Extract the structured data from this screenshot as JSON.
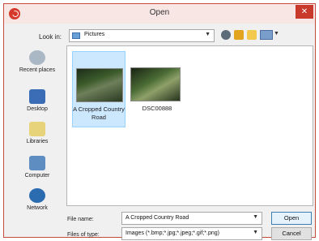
{
  "window": {
    "title": "Open"
  },
  "lookin": {
    "label": "Look in:",
    "value": "Pictures"
  },
  "places": [
    {
      "label": "Recent places"
    },
    {
      "label": "Desktop"
    },
    {
      "label": "Libraries"
    },
    {
      "label": "Computer"
    },
    {
      "label": "Network"
    }
  ],
  "files": [
    {
      "name": "A Cropped Country Road",
      "selected": true
    },
    {
      "name": "DSC00888",
      "selected": false
    }
  ],
  "filename": {
    "label": "File name:",
    "value": "A Cropped Country Road"
  },
  "filetype": {
    "label": "Files of type:",
    "value": "Images (*.bmp;*.jpg;*.jpeg;*.gif;*.png)"
  },
  "buttons": {
    "open": "Open",
    "cancel": "Cancel"
  },
  "colors": {
    "accent": "#c8392b",
    "selection": "#cce8ff"
  }
}
